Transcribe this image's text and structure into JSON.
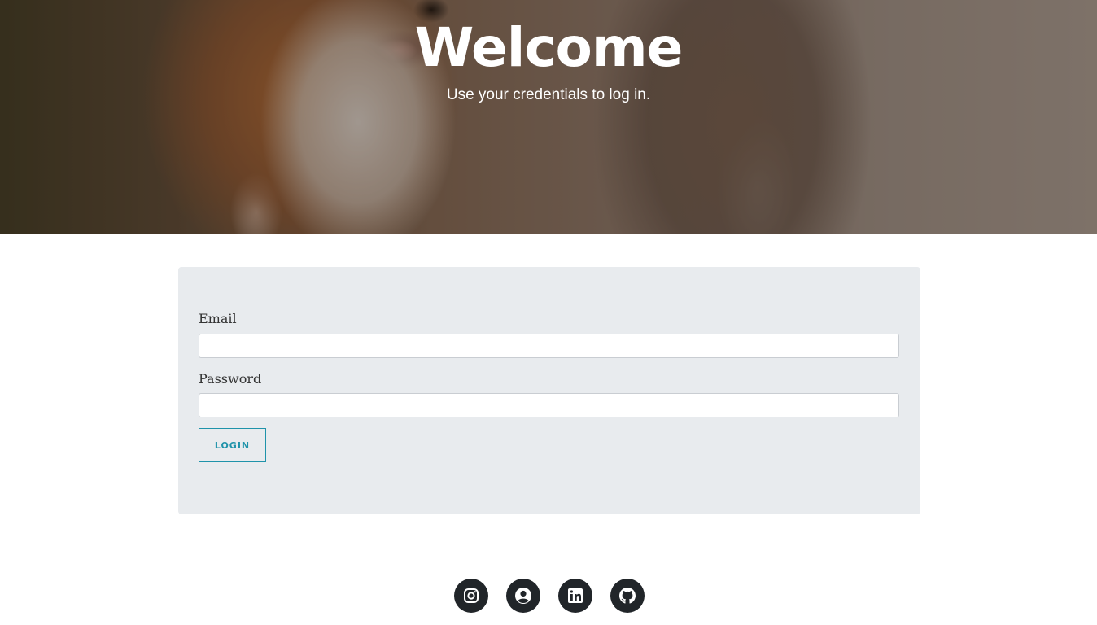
{
  "hero": {
    "title": "Welcome",
    "subtitle": "Use your credentials to log in."
  },
  "login_form": {
    "email_label": "Email",
    "email_value": "",
    "password_label": "Password",
    "password_value": "",
    "login_button": "LOGIN"
  },
  "social_links": [
    {
      "icon": "instagram-icon"
    },
    {
      "icon": "user-circle-icon"
    },
    {
      "icon": "linkedin-icon"
    },
    {
      "icon": "github-icon"
    }
  ],
  "colors": {
    "accent": "#1f93aa",
    "panel_background": "#e8ebee",
    "social_background": "#212529"
  }
}
